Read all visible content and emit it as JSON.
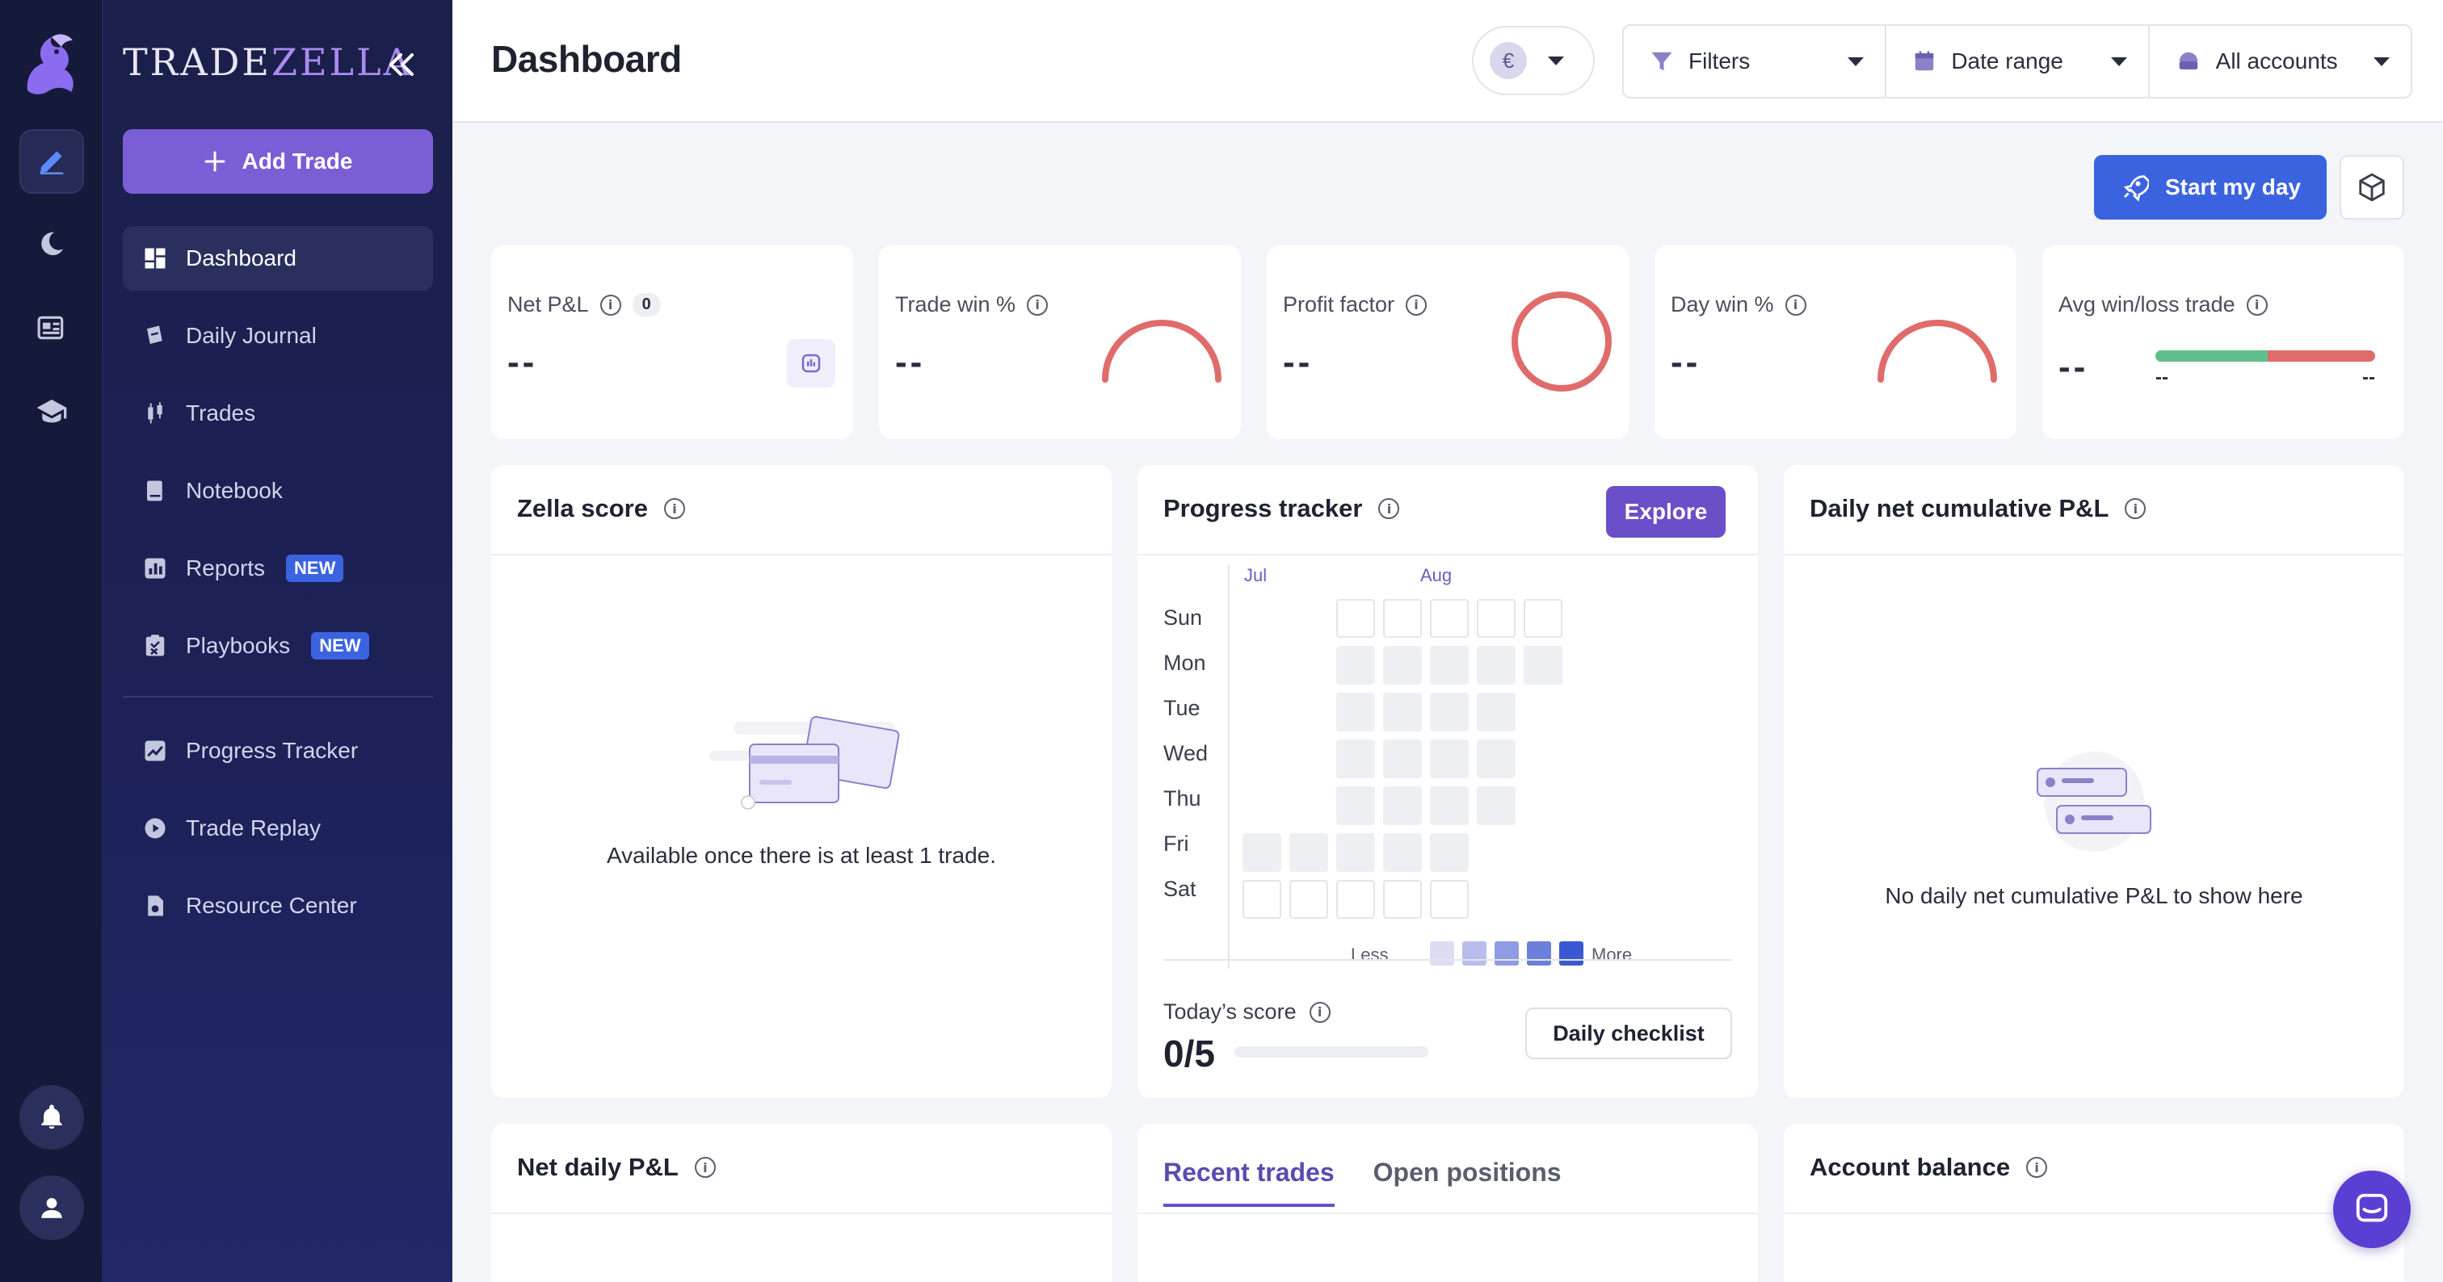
{
  "brand": {
    "prefix": "TRADE",
    "suffix": "ZELLA"
  },
  "sidebar": {
    "add_trade_label": "Add Trade",
    "items": [
      {
        "label": "Dashboard",
        "icon": "dashboard-icon",
        "badge": ""
      },
      {
        "label": "Daily Journal",
        "icon": "journal-icon",
        "badge": ""
      },
      {
        "label": "Trades",
        "icon": "trades-icon",
        "badge": ""
      },
      {
        "label": "Notebook",
        "icon": "notebook-icon",
        "badge": ""
      },
      {
        "label": "Reports",
        "icon": "reports-icon",
        "badge": "NEW"
      },
      {
        "label": "Playbooks",
        "icon": "playbooks-icon",
        "badge": "NEW"
      },
      {
        "label": "Progress Tracker",
        "icon": "progress-icon",
        "badge": ""
      },
      {
        "label": "Trade Replay",
        "icon": "replay-icon",
        "badge": ""
      },
      {
        "label": "Resource Center",
        "icon": "resource-icon",
        "badge": ""
      }
    ]
  },
  "header": {
    "title": "Dashboard",
    "currency_symbol": "€",
    "filters_label": "Filters",
    "date_range_label": "Date range",
    "accounts_label": "All accounts",
    "start_day_label": "Start my day"
  },
  "stats": [
    {
      "title": "Net P&L",
      "value": "--",
      "count": "0"
    },
    {
      "title": "Trade win %",
      "value": "--"
    },
    {
      "title": "Profit factor",
      "value": "--"
    },
    {
      "title": "Day win %",
      "value": "--"
    },
    {
      "title": "Avg win/loss trade",
      "value": "--",
      "win": "--",
      "loss": "--"
    }
  ],
  "zella": {
    "title": "Zella score",
    "empty": "Available once there is at least 1 trade."
  },
  "progress": {
    "title": "Progress tracker",
    "explore_label": "Explore",
    "months": [
      "Jul",
      "Aug"
    ],
    "days": [
      "Sun",
      "Mon",
      "Tue",
      "Wed",
      "Thu",
      "Fri",
      "Sat"
    ],
    "legend_less": "Less",
    "legend_more": "More",
    "today_label": "Today’s score",
    "today_value": "0/5",
    "today_fraction": 0,
    "checklist_label": "Daily checklist"
  },
  "cumulative": {
    "title": "Daily net cumulative P&L",
    "empty": "No daily net cumulative P&L to show here"
  },
  "net_daily": {
    "title": "Net daily P&L"
  },
  "trades_tabs": {
    "recent": "Recent trades",
    "open": "Open positions"
  },
  "account_balance": {
    "title": "Account balance"
  },
  "colors": {
    "accent": "#6a4fc8",
    "primary_blue": "#3b63e0",
    "win_green": "#5fbf8a",
    "loss_red": "#e06b6b"
  }
}
